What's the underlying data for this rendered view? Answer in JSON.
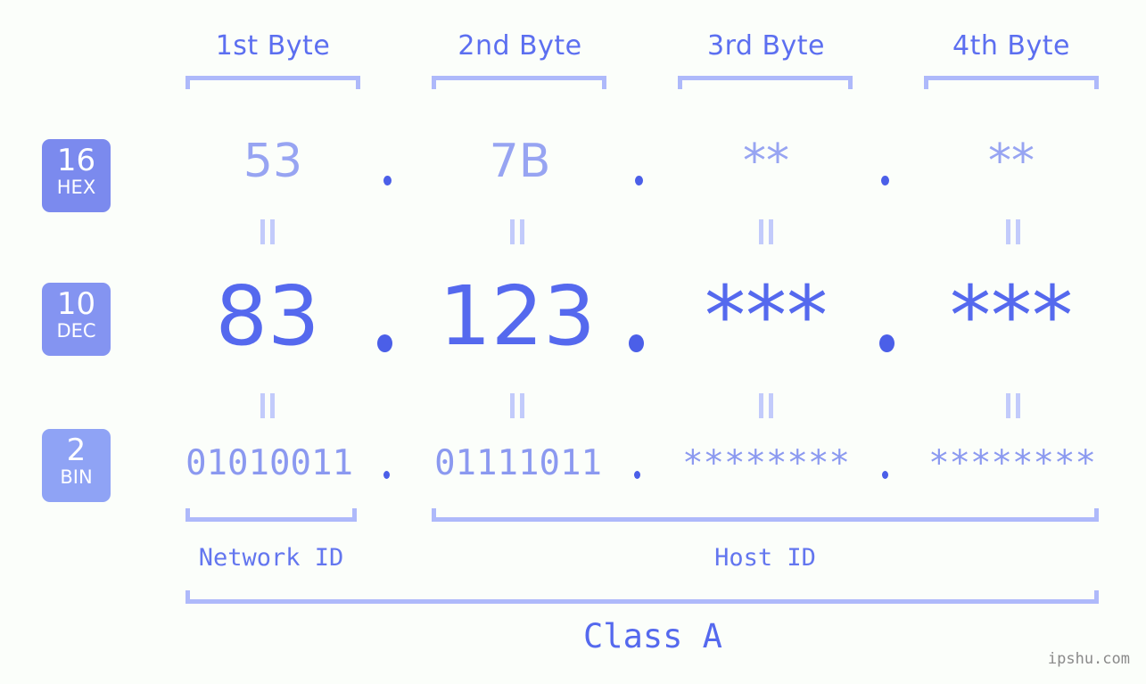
{
  "page": {
    "background_color": "#fbfefa",
    "accent_strong": "#5569ee",
    "accent_mid": "#8b99f0",
    "accent_light": "#aeb9fa",
    "watermark": "ipshu.com"
  },
  "byte_headers": [
    {
      "label": "1st Byte"
    },
    {
      "label": "2nd Byte"
    },
    {
      "label": "3rd Byte"
    },
    {
      "label": "4th Byte"
    }
  ],
  "rows": [
    {
      "key": "hex",
      "badge_number": "16",
      "badge_name": "HEX",
      "badge_color": "#7b8aee",
      "values": [
        "53",
        "7B",
        "**",
        "**"
      ],
      "separator": "."
    },
    {
      "key": "dec",
      "badge_number": "10",
      "badge_name": "DEC",
      "badge_color": "#8494f1",
      "values": [
        "83",
        "123",
        "***",
        "***"
      ],
      "separator": "."
    },
    {
      "key": "bin",
      "badge_number": "2",
      "badge_name": "BIN",
      "badge_color": "#8fa3f5",
      "values": [
        "01010011",
        "01111011",
        "********",
        "********"
      ],
      "separator": "."
    }
  ],
  "equality_marks": {
    "symbol": "||",
    "count_per_row": 4
  },
  "id_sections": [
    {
      "label": "Network ID"
    },
    {
      "label": "Host ID"
    }
  ],
  "class_section": {
    "label": "Class A"
  }
}
